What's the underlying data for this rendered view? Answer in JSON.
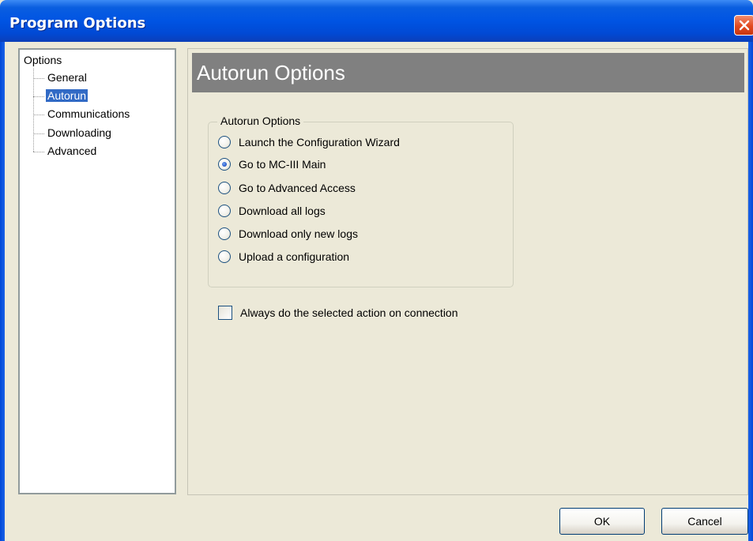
{
  "window": {
    "title": "Program Options"
  },
  "tree": {
    "root": "Options",
    "items": [
      {
        "label": "General",
        "selected": false
      },
      {
        "label": "Autorun",
        "selected": true
      },
      {
        "label": "Communications",
        "selected": false
      },
      {
        "label": "Downloading",
        "selected": false
      },
      {
        "label": "Advanced",
        "selected": false
      }
    ]
  },
  "panel": {
    "header": "Autorun Options",
    "group_title": "Autorun Options",
    "options": [
      {
        "label": "Launch the Configuration Wizard",
        "checked": false
      },
      {
        "label": "Go to MC-III Main",
        "checked": true
      },
      {
        "label": "Go to Advanced Access",
        "checked": false
      },
      {
        "label": "Download all logs",
        "checked": false
      },
      {
        "label": "Download only new logs",
        "checked": false
      },
      {
        "label": "Upload a configuration",
        "checked": false
      }
    ],
    "always_checkbox": {
      "label": "Always do the selected action on connection",
      "checked": false
    }
  },
  "buttons": {
    "ok": "OK",
    "cancel": "Cancel"
  },
  "colors": {
    "titlebar": "#0054e3",
    "header_bg": "#808080",
    "selection": "#316ac5",
    "dialog_bg": "#ece9d8"
  },
  "icons": {
    "close": "close-icon"
  }
}
